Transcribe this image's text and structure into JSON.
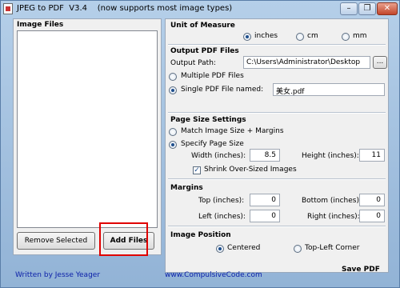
{
  "window": {
    "title": "JPEG to PDF  V3.4    (now supports most image types)",
    "minimize_glyph": "–",
    "restore_glyph": "❐",
    "close_glyph": "✕"
  },
  "left_panel": {
    "header": "Image Files",
    "remove_selected": "Remove Selected",
    "add_files": "Add Files"
  },
  "unit_of_measure": {
    "header": "Unit of Measure",
    "options": [
      "inches",
      "cm",
      "mm"
    ],
    "selected": "inches"
  },
  "output": {
    "header": "Output PDF Files",
    "path_label": "Output Path:",
    "path_value": "C:\\Users\\Administrator\\Desktop",
    "browse_label": "...",
    "multiple_label": "Multiple PDF Files",
    "single_label": "Single PDF File named:",
    "file_name": "美女.pdf",
    "selected": "single"
  },
  "page_size": {
    "header": "Page Size Settings",
    "match_label": "Match Image Size + Margins",
    "specify_label": "Specify Page Size",
    "selected": "specify",
    "width_label": "Width (inches):",
    "width_value": "8.5",
    "height_label": "Height (inches):",
    "height_value": "11",
    "shrink_label": "Shrink Over-Sized Images",
    "shrink_checked": true
  },
  "margins": {
    "header": "Margins",
    "top_label": "Top (inches):",
    "top_value": "0",
    "bottom_label": "Bottom (inches):",
    "bottom_value": "0",
    "left_label": "Left (inches):",
    "left_value": "0",
    "right_label": "Right (inches):",
    "right_value": "0"
  },
  "image_position": {
    "header": "Image Position",
    "centered_label": "Centered",
    "topleft_label": "Top-Left Corner",
    "selected": "centered"
  },
  "save_pdf": "Save PDF",
  "status": {
    "author": "Written by Jesse Yeager",
    "website": "www.CompulsiveCode.com"
  },
  "colors": {
    "highlight": "#e00000",
    "status_link": "#0a1ea8"
  }
}
